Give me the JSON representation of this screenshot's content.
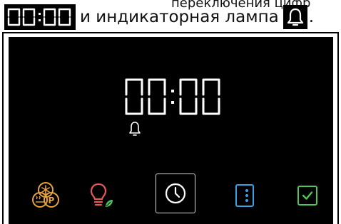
{
  "header": {
    "faint_text": "переключения цифр",
    "display_digits": "00:00",
    "text": "и индикаторная лампа",
    "trailing": "."
  },
  "display": {
    "time": "00:00",
    "bell_indicator": "bell-icon"
  },
  "controls": [
    {
      "name": "hot-air-program-button",
      "icon": "hot-air-p-icon",
      "color": "#e8a33a"
    },
    {
      "name": "lamp-eco-button",
      "icon": "lamp-leaf-icon",
      "color": "#e8575a"
    },
    {
      "name": "clock-button",
      "icon": "clock-icon",
      "color": "#ffffff"
    },
    {
      "name": "menu-button",
      "icon": "vertical-dots-icon",
      "color": "#3aa0e8"
    },
    {
      "name": "ok-button",
      "icon": "check-icon",
      "color": "#4cc85a"
    }
  ],
  "colors": {
    "panel_bg": "#000000",
    "accent_orange": "#e8a33a",
    "accent_red": "#e8575a",
    "accent_blue": "#3aa0e8",
    "accent_green": "#4cc85a"
  }
}
